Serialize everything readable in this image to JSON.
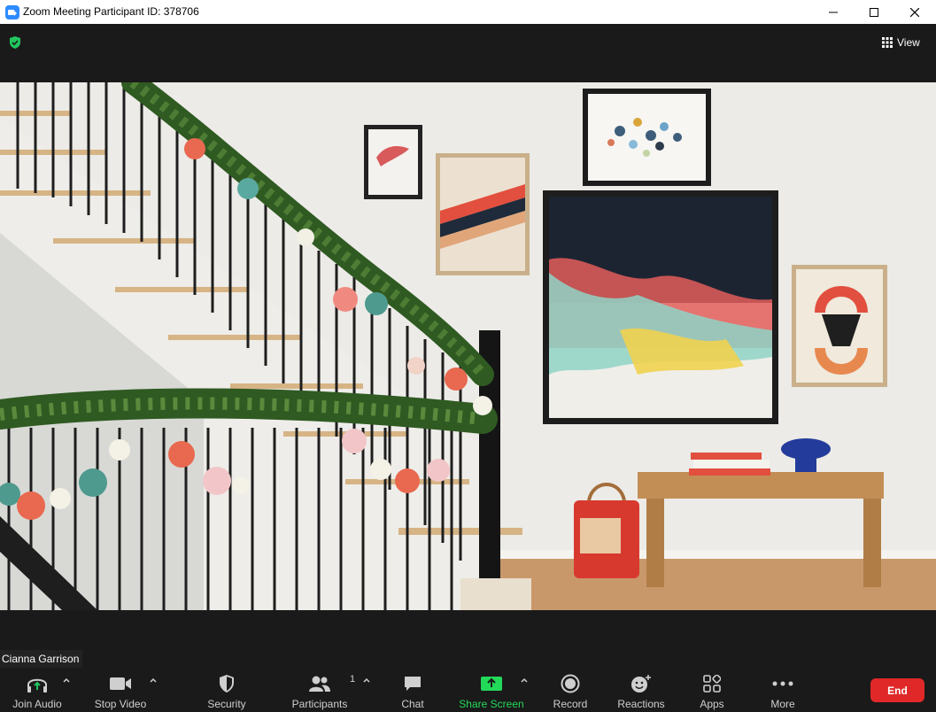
{
  "window": {
    "title": "Zoom Meeting Participant ID: 378706"
  },
  "header": {
    "view_label": "View"
  },
  "participant": {
    "name": "Cianna Garrison"
  },
  "toolbar": {
    "join_audio": "Join Audio",
    "stop_video": "Stop Video",
    "security": "Security",
    "participants": "Participants",
    "participants_count": "1",
    "chat": "Chat",
    "share_screen": "Share Screen",
    "record": "Record",
    "reactions": "Reactions",
    "apps": "Apps",
    "more": "More",
    "end": "End"
  },
  "colors": {
    "accent_green": "#22c55e",
    "share_green": "#23d959",
    "end_red": "#e02828",
    "app_blue": "#2d8cff"
  }
}
